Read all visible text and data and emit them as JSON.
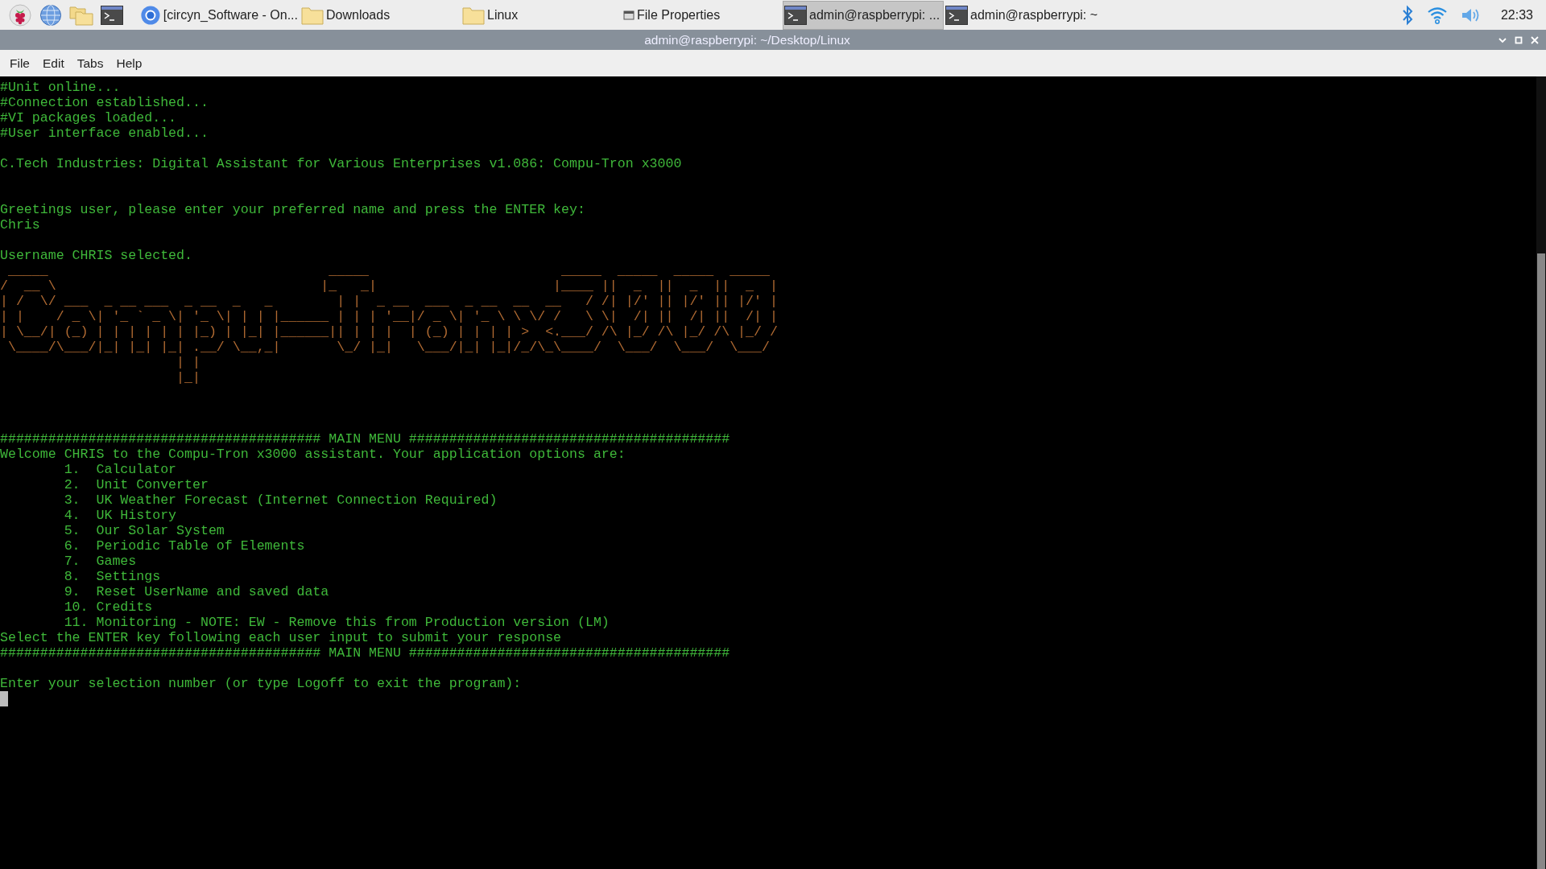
{
  "taskbar": {
    "launchers": [
      {
        "kind": "menu"
      },
      {
        "kind": "browser"
      },
      {
        "kind": "files"
      },
      {
        "kind": "terminal"
      }
    ],
    "tasks": [
      {
        "kind": "browser",
        "label": "[circyn_Software - On...",
        "selected": false
      },
      {
        "kind": "folder",
        "label": "Downloads",
        "selected": false
      },
      {
        "kind": "folder",
        "label": "Linux",
        "selected": false
      },
      {
        "kind": "properties",
        "label": "File Properties",
        "selected": false
      },
      {
        "kind": "terminal",
        "label": "admin@raspberrypi: ...",
        "selected": true
      },
      {
        "kind": "terminal",
        "label": "admin@raspberrypi: ~",
        "selected": false
      }
    ],
    "tray": [
      {
        "kind": "bluetooth"
      },
      {
        "kind": "wifi"
      },
      {
        "kind": "volume"
      }
    ],
    "clock": "22:33"
  },
  "window": {
    "title": "admin@raspberrypi: ~/Desktop/Linux"
  },
  "menu": [
    "File",
    "Edit",
    "Tabs",
    "Help"
  ],
  "terminal": {
    "lines": [
      {
        "kind": "text",
        "text": "#Unit online..."
      },
      {
        "kind": "text",
        "text": "#Connection established..."
      },
      {
        "kind": "text",
        "text": "#VI packages loaded..."
      },
      {
        "kind": "text",
        "text": "#User interface enabled..."
      },
      {
        "kind": "blank"
      },
      {
        "kind": "text",
        "text": "C.Tech Industries: Digital Assistant for Various Enterprises v1.086: Compu-Tron x3000"
      },
      {
        "kind": "blank"
      },
      {
        "kind": "blank"
      },
      {
        "kind": "text",
        "text": "Greetings user, please enter your preferred name and press the ENTER key:"
      },
      {
        "kind": "text",
        "text": "Chris"
      },
      {
        "kind": "blank"
      },
      {
        "kind": "text",
        "text": "Username CHRIS selected."
      },
      {
        "kind": "art",
        "text": " _____                                   _____                        _____  _____  _____  _____"
      },
      {
        "kind": "art",
        "text": "/  __ \\                                 |_   _|                      |____ ||  _  ||  _  ||  _  |"
      },
      {
        "kind": "art",
        "text": "| /  \\/ ___  _ __ ___  _ __  _   _        | |  _ __  ___  _ __  __  __   / /| |/' || |/' || |/' |"
      },
      {
        "kind": "art",
        "text": "| |    / _ \\| '_ ` _ \\| '_ \\| | | |______ | | | '__|/ _ \\| '_ \\ \\ \\/ /   \\ \\|  /| ||  /| ||  /| |"
      },
      {
        "kind": "art",
        "text": "| \\__/| (_) | | | | | | |_) | |_| |______|| | | |  | (_) | | | | >  <.___/ /\\ |_/ /\\ |_/ /\\ |_/ /"
      },
      {
        "kind": "art",
        "text": " \\____/\\___/|_| |_| |_| .__/ \\__,_|       \\_/ |_|   \\___/|_| |_|/_/\\_\\____/  \\___/  \\___/  \\___/"
      },
      {
        "kind": "art",
        "text": "                      | |"
      },
      {
        "kind": "art",
        "text": "                      |_|"
      },
      {
        "kind": "blank"
      },
      {
        "kind": "blank"
      },
      {
        "kind": "blank"
      },
      {
        "kind": "text",
        "text": "######################################## MAIN MENU ########################################"
      },
      {
        "kind": "text",
        "text": "Welcome CHRIS to the Compu-Tron x3000 assistant. Your application options are:"
      },
      {
        "kind": "item",
        "text": "1.  Calculator"
      },
      {
        "kind": "item",
        "text": "2.  Unit Converter"
      },
      {
        "kind": "item",
        "text": "3.  UK Weather Forecast (Internet Connection Required)"
      },
      {
        "kind": "item",
        "text": "4.  UK History"
      },
      {
        "kind": "item",
        "text": "5.  Our Solar System"
      },
      {
        "kind": "item",
        "text": "6.  Periodic Table of Elements"
      },
      {
        "kind": "item",
        "text": "7.  Games"
      },
      {
        "kind": "item",
        "text": "8.  Settings"
      },
      {
        "kind": "item",
        "text": "9.  Reset UserName and saved data"
      },
      {
        "kind": "item",
        "text": "10. Credits"
      },
      {
        "kind": "item",
        "text": "11. Monitoring - NOTE: EW - Remove this from Production version (LM)"
      },
      {
        "kind": "text",
        "text": "Select the ENTER key following each user input to submit your response"
      },
      {
        "kind": "text",
        "text": "######################################## MAIN MENU ########################################"
      },
      {
        "kind": "blank"
      },
      {
        "kind": "text",
        "text": "Enter your selection number (or type Logoff to exit the program):"
      },
      {
        "kind": "cursor"
      }
    ]
  }
}
